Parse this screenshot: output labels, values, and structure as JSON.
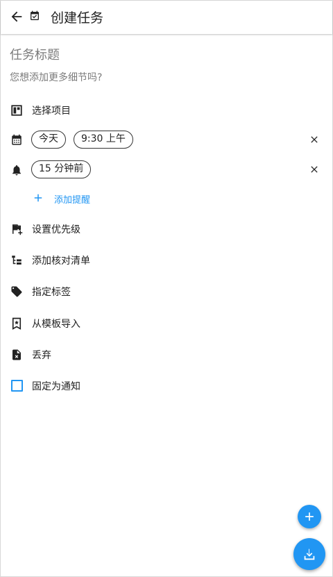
{
  "appbar": {
    "title": "创建任务",
    "back_icon": "arrow-back-icon",
    "task_icon": "calendar-check-icon"
  },
  "task": {
    "title_placeholder": "任务标题",
    "description_placeholder": "您想添加更多细节吗?"
  },
  "project": {
    "label": "选择项目",
    "icon": "project-board-icon"
  },
  "date": {
    "day_chip": "今天",
    "time_chip": "9:30 上午",
    "icon": "calendar-icon"
  },
  "reminder": {
    "chip": "15 分钟前",
    "add_label": "添加提醒",
    "icon": "bell-icon"
  },
  "menu": {
    "priority": "设置优先级",
    "checklist": "添加核对清单",
    "tags": "指定标签",
    "template": "从模板导入",
    "discard": "丢弃",
    "pin": "固定为通知"
  },
  "colors": {
    "accent": "#2196f3",
    "text": "#212121",
    "hint": "#7b7b7b"
  }
}
